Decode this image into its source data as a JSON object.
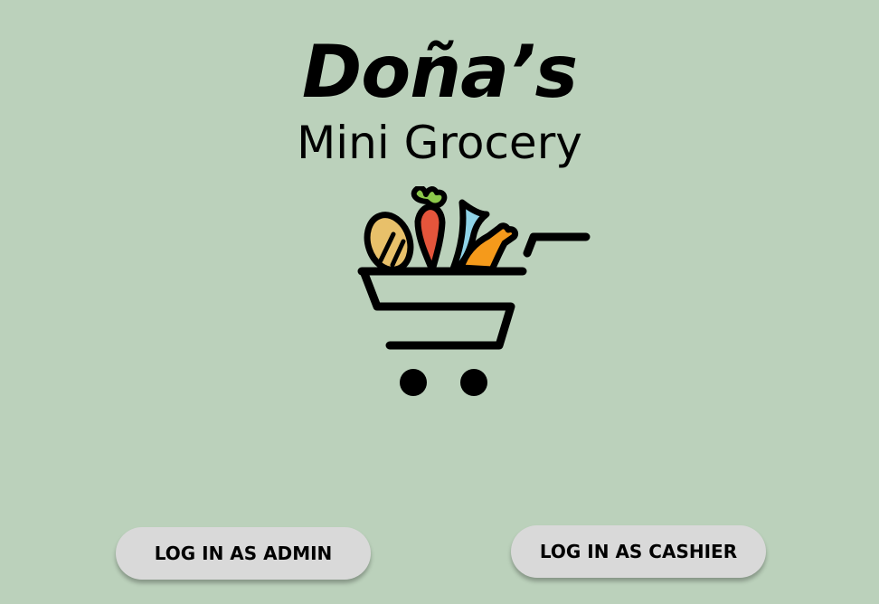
{
  "brand": {
    "title": "Doña’s",
    "subtitle": "Mini Grocery",
    "logo_icon": "grocery-cart-icon"
  },
  "actions": {
    "admin_login_label": "LOG IN AS ADMIN",
    "cashier_login_label": "LOG IN AS CASHIER"
  },
  "colors": {
    "background": "#bbd1bb",
    "button_background": "#d9d9d9",
    "text": "#000000",
    "carrot": "#e4553b",
    "leaf": "#8cc84b",
    "fish": "#8fd3e7",
    "chicken": "#f59a1b",
    "bread": "#e8c06a"
  }
}
